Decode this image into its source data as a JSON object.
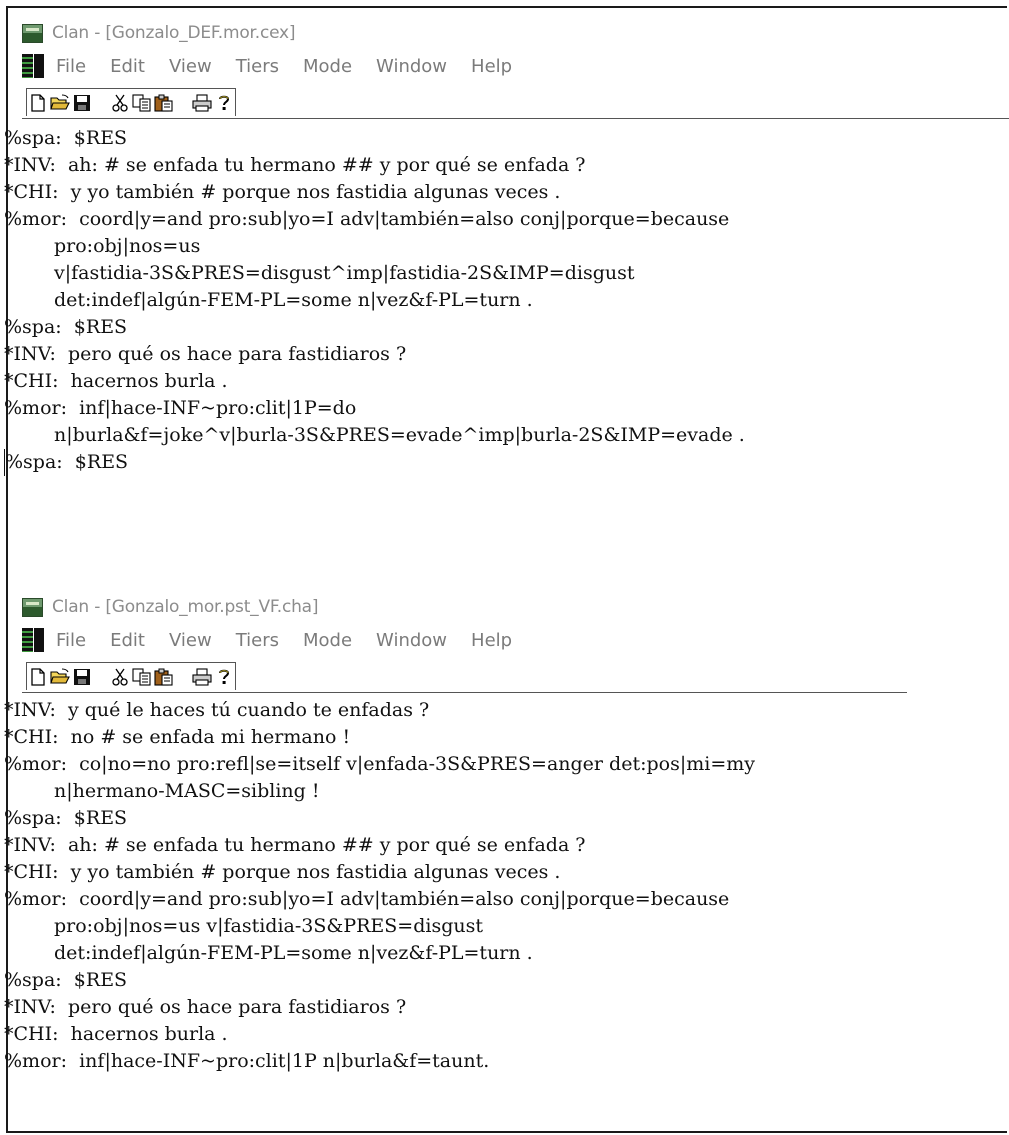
{
  "windows": [
    {
      "title": "Clan - [Gonzalo_DEF.mor.cex]",
      "menu": [
        "File",
        "Edit",
        "View",
        "Tiers",
        "Mode",
        "Window",
        "Help"
      ],
      "lines": [
        {
          "tier": "%spa:",
          "text": "$RES",
          "cont": []
        },
        {
          "tier": "*INV:",
          "text": "ah: # se enfada tu hermano ## y por qué se enfada ?",
          "cont": []
        },
        {
          "tier": "*CHI:",
          "text": "y yo también # porque nos fastidia algunas veces .",
          "cont": []
        },
        {
          "tier": "%mor:",
          "text": "coord|y=and pro:sub|yo=I adv|también=also conj|porque=because",
          "cont": [
            "pro:obj|nos=us",
            "v|fastidia-3S&PRES=disgust^imp|fastidia-2S&IMP=disgust",
            "det:indef|algún-FEM-PL=some n|vez&f-PL=turn ."
          ]
        },
        {
          "tier": "%spa:",
          "text": "$RES",
          "cont": []
        },
        {
          "tier": "*INV:",
          "text": "pero qué os hace para fastidiaros ?",
          "cont": []
        },
        {
          "tier": "*CHI:",
          "text": "hacernos burla .",
          "cont": []
        },
        {
          "tier": "%mor:",
          "text": "inf|hace-INF~pro:clit|1P=do",
          "cont": [
            "n|burla&f=joke^v|burla-3S&PRES=evade^imp|burla-2S&IMP=evade ."
          ]
        },
        {
          "tier": "%spa:",
          "text": "$RES",
          "cont": []
        }
      ]
    },
    {
      "title": "Clan - [Gonzalo_mor.pst_VF.cha]",
      "menu": [
        "File",
        "Edit",
        "View",
        "Tiers",
        "Mode",
        "Window",
        "Help"
      ],
      "lines": [
        {
          "tier": "*INV:",
          "text": "y qué le haces tú cuando te enfadas ?",
          "cont": []
        },
        {
          "tier": "*CHI:",
          "text": "no # se enfada mi hermano !",
          "cont": []
        },
        {
          "tier": "%mor:",
          "text": "co|no=no pro:refl|se=itself v|enfada-3S&PRES=anger det:pos|mi=my",
          "cont": [
            "n|hermano-MASC=sibling !"
          ]
        },
        {
          "tier": "%spa:",
          "text": "$RES",
          "cont": []
        },
        {
          "tier": "*INV:",
          "text": "ah: # se enfada tu hermano ## y por qué se enfada ?",
          "cont": []
        },
        {
          "tier": "*CHI:",
          "text": "y yo también # porque nos fastidia algunas veces .",
          "cont": []
        },
        {
          "tier": "%mor:",
          "text": "coord|y=and pro:sub|yo=I adv|también=also conj|porque=because",
          "cont": [
            "pro:obj|nos=us v|fastidia-3S&PRES=disgust",
            "det:indef|algún-FEM-PL=some n|vez&f-PL=turn ."
          ]
        },
        {
          "tier": "%spa:",
          "text": "$RES",
          "cont": []
        },
        {
          "tier": "*INV:",
          "text": "pero qué os hace para fastidiaros ?",
          "cont": []
        },
        {
          "tier": "*CHI:",
          "text": "hacernos burla .",
          "cont": []
        },
        {
          "tier": "%mor:",
          "text": "inf|hace-INF~pro:clit|1P n|burla&f=taunt.",
          "cont": []
        }
      ]
    }
  ],
  "toolbar_icons": [
    "new-file-icon",
    "open-folder-icon",
    "save-icon",
    "cut-icon",
    "copy-icon",
    "paste-icon",
    "print-icon",
    "help-icon"
  ]
}
